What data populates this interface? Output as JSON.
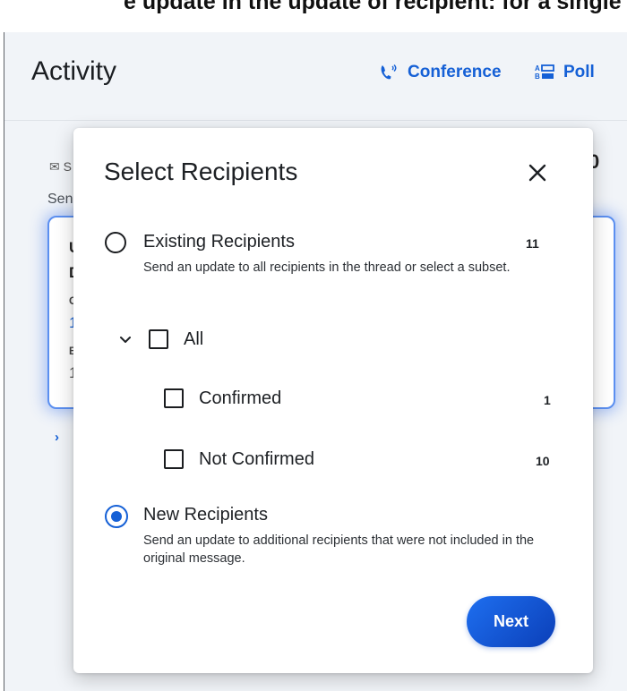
{
  "top_strip_text": "e update in the update of recipient: for a single",
  "header": {
    "title": "Activity",
    "conference_label": "Conference",
    "poll_label": "Poll"
  },
  "background": {
    "meta": "S",
    "sent": "Sen",
    "card": {
      "line1": "U",
      "line2": "D",
      "label1": "C",
      "value1": "1",
      "label2": "B",
      "value2": "1"
    },
    "chevron": "›",
    "right_fragment": "0"
  },
  "modal": {
    "title": "Select Recipients",
    "close_icon": "close-icon",
    "existing": {
      "label": "Existing Recipients",
      "count": "11",
      "description": "Send an update to all recipients in the thread or select a subset.",
      "selected": false
    },
    "all": {
      "label": "All"
    },
    "confirmed": {
      "label": "Confirmed",
      "count": "1"
    },
    "not_confirmed": {
      "label": "Not Confirmed",
      "count": "10"
    },
    "new": {
      "label": "New Recipients",
      "description": "Send an update to additional recipients that were not included in the original message.",
      "selected": true
    },
    "next_label": "Next"
  },
  "colors": {
    "accent": "#1560d6",
    "button_gradient_start": "#1e6ff0",
    "button_gradient_end": "#0b3fb8",
    "background": "#f1f4f8"
  }
}
